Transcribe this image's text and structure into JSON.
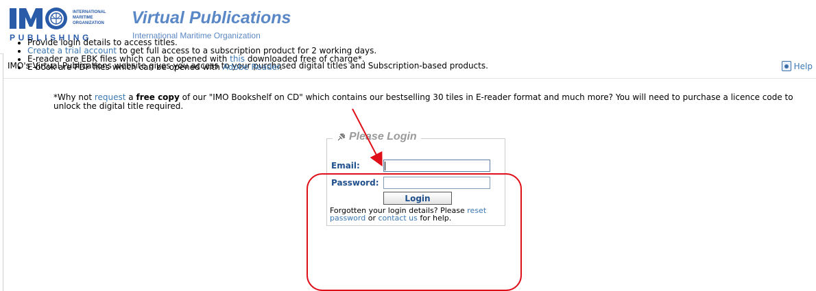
{
  "header": {
    "logo_lines": [
      "INTERNATIONAL",
      "MARITIME",
      "ORGANIZATION"
    ],
    "logo_publishing": "PUBLISHING",
    "title": "Virtual Publications",
    "subtitle": "International Maritime Organization"
  },
  "intro": {
    "text": "IMO's Virtual Publications website gives you access to your purchased digital titles and Subscription-based products.",
    "help_label": "Help",
    "help_icon": "help-book-icon"
  },
  "bullets": {
    "b1": "Provide login details to access titles.",
    "b2_link": "Create a trial account",
    "b2_rest": " to get full access to a subscription product for 2 working days.",
    "b3_pre": "E-reader are EBK files which can be opened with ",
    "b3_link": "this",
    "b3_rest": " downloaded free of charge*.",
    "b4_pre": "E-book are PDF files which can be opened with ",
    "b4_link": "Adobe Reader",
    "b4_rest": "."
  },
  "note": {
    "pre": "*Why not ",
    "link": "request",
    "mid1": " a ",
    "bold": "free copy",
    "rest": " of our \"IMO Bookshelf on CD\" which contains our bestselling 30 tiles in E-reader format and much more? You will need to purchase a licence code to unlock the digital title required."
  },
  "login": {
    "title": "Please Login",
    "title_icon": "pin-icon",
    "email_label": "Email:",
    "email_value": "",
    "password_label": "Password:",
    "password_value": "",
    "button_label": "Login",
    "forgot_pre": "Forgotten your login details? Please ",
    "reset_link": "reset password",
    "forgot_mid": " or ",
    "contact_link": "contact us",
    "forgot_post": " for help."
  },
  "colors": {
    "link": "#3b78b4",
    "brand": "#5a87c5",
    "label": "#1f4f8c",
    "annotation": "#e0101a"
  }
}
